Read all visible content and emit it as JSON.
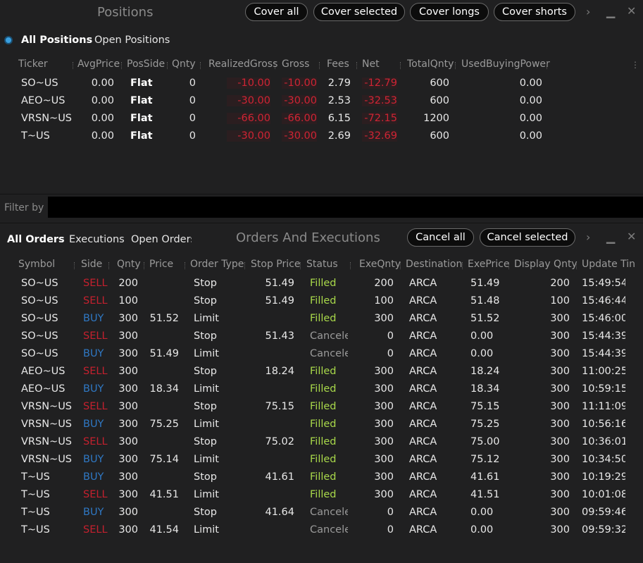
{
  "positions": {
    "title": "Positions",
    "buttons": [
      "Cover all",
      "Cover selected",
      "Cover longs",
      "Cover shorts"
    ],
    "tabs": [
      "All Positions",
      "Open Positions"
    ],
    "columns": [
      "Ticker",
      "AvgPrice",
      "PosSide",
      "Qnty",
      "RealizedGross",
      "Gross",
      "Fees",
      "Net",
      "TotalQnty",
      "UsedBuyingPower"
    ],
    "rows": [
      [
        "SO~US",
        "0.00",
        "Flat",
        "0",
        "-10.00",
        "-10.00",
        "2.79",
        "-12.79",
        "600",
        "0.00"
      ],
      [
        "AEO~US",
        "0.00",
        "Flat",
        "0",
        "-30.00",
        "-30.00",
        "2.53",
        "-32.53",
        "600",
        "0.00"
      ],
      [
        "VRSN~US",
        "0.00",
        "Flat",
        "0",
        "-66.00",
        "-66.00",
        "6.15",
        "-72.15",
        "1200",
        "0.00"
      ],
      [
        "T~US",
        "0.00",
        "Flat",
        "0",
        "-30.00",
        "-30.00",
        "2.69",
        "-32.69",
        "600",
        "0.00"
      ]
    ]
  },
  "filter": {
    "label": "Filter by",
    "value": ""
  },
  "orders": {
    "title": "Orders And Executions",
    "tabs": [
      "All Orders",
      "Executions",
      "Open Orders"
    ],
    "buttons": [
      "Cancel all",
      "Cancel selected"
    ],
    "columns": [
      "Symbol",
      "Side",
      "Qnty",
      "Price",
      "Order Type",
      "Stop Price",
      "Status",
      "ExeQnty",
      "Destination",
      "ExePrice",
      "Display Qnty",
      "Update Tin"
    ],
    "rows": [
      [
        "SO~US",
        "SELL",
        "200",
        "",
        "Stop",
        "51.49",
        "Filled",
        "200",
        "ARCA",
        "51.49",
        "200",
        "15:49:54"
      ],
      [
        "SO~US",
        "SELL",
        "100",
        "",
        "Stop",
        "51.49",
        "Filled",
        "100",
        "ARCA",
        "51.48",
        "100",
        "15:46:44"
      ],
      [
        "SO~US",
        "BUY",
        "300",
        "51.52",
        "Limit",
        "",
        "Filled",
        "300",
        "ARCA",
        "51.52",
        "300",
        "15:46:00"
      ],
      [
        "SO~US",
        "SELL",
        "300",
        "",
        "Stop",
        "51.43",
        "Canceled",
        "0",
        "ARCA",
        "0.00",
        "300",
        "15:44:39"
      ],
      [
        "SO~US",
        "BUY",
        "300",
        "51.49",
        "Limit",
        "",
        "Canceled",
        "0",
        "ARCA",
        "0.00",
        "300",
        "15:44:39"
      ],
      [
        "AEO~US",
        "SELL",
        "300",
        "",
        "Stop",
        "18.24",
        "Filled",
        "300",
        "ARCA",
        "18.24",
        "300",
        "11:00:25"
      ],
      [
        "AEO~US",
        "BUY",
        "300",
        "18.34",
        "Limit",
        "",
        "Filled",
        "300",
        "ARCA",
        "18.34",
        "300",
        "10:59:15"
      ],
      [
        "VRSN~US",
        "SELL",
        "300",
        "",
        "Stop",
        "75.15",
        "Filled",
        "300",
        "ARCA",
        "75.15",
        "300",
        "11:11:09"
      ],
      [
        "VRSN~US",
        "BUY",
        "300",
        "75.25",
        "Limit",
        "",
        "Filled",
        "300",
        "ARCA",
        "75.25",
        "300",
        "10:56:16"
      ],
      [
        "VRSN~US",
        "SELL",
        "300",
        "",
        "Stop",
        "75.02",
        "Filled",
        "300",
        "ARCA",
        "75.00",
        "300",
        "10:36:01"
      ],
      [
        "VRSN~US",
        "BUY",
        "300",
        "75.14",
        "Limit",
        "",
        "Filled",
        "300",
        "ARCA",
        "75.12",
        "300",
        "10:34:50"
      ],
      [
        "T~US",
        "BUY",
        "300",
        "",
        "Stop",
        "41.61",
        "Filled",
        "300",
        "ARCA",
        "41.61",
        "300",
        "10:19:29"
      ],
      [
        "T~US",
        "SELL",
        "300",
        "41.51",
        "Limit",
        "",
        "Filled",
        "300",
        "ARCA",
        "41.51",
        "300",
        "10:01:08"
      ],
      [
        "T~US",
        "BUY",
        "300",
        "",
        "Stop",
        "41.64",
        "Canceled",
        "0",
        "ARCA",
        "0.00",
        "300",
        "09:59:46"
      ],
      [
        "T~US",
        "SELL",
        "300",
        "41.54",
        "Limit",
        "",
        "Canceled",
        "0",
        "ARCA",
        "0.00",
        "300",
        "09:59:32"
      ]
    ]
  },
  "icons": {
    "next": "chevron-right-icon",
    "minimize": "minimize-icon",
    "close": "close-icon",
    "menu": "column-menu-icon"
  }
}
